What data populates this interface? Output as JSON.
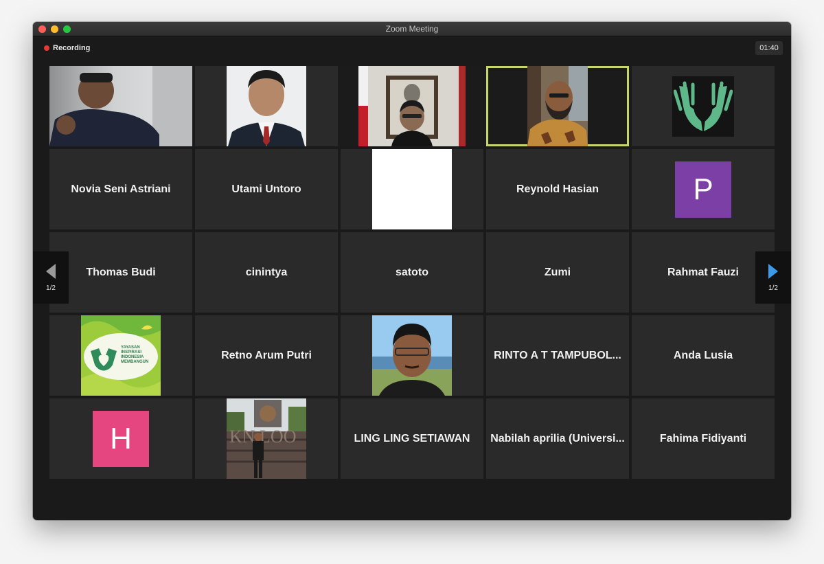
{
  "window": {
    "title": "Zoom Meeting"
  },
  "recording": {
    "label": "Recording"
  },
  "timer": "01:40",
  "nav": {
    "prev_page": "1/2",
    "next_page": "1/2"
  },
  "participants": {
    "novia": "Novia Seni Astriani",
    "utami": "Utami Untoro",
    "reynold": "Reynold Hasian",
    "p_initial": "P",
    "thomas": "Thomas Budi",
    "cinintya": "cinintya",
    "satoto": "satoto",
    "zumi": "Zumi",
    "rahmat": "Rahmat Fauzi",
    "retno": "Retno Arum Putri",
    "rinto": "RINTO A T TAMPUBOL...",
    "anda": "Anda Lusia",
    "h_initial": "H",
    "ling": "LING LING SETIAWAN",
    "nabilah": "Nabilah aprilia (Universi...",
    "fahima": "Fahima Fidiyanti"
  },
  "logo": {
    "yayasan": "YAYASAN",
    "inspirasi": "INSPIRASI",
    "indonesia": "INDONESIA",
    "membangun": "MEMBANGUN"
  },
  "colors": {
    "p_avatar": "#7b3fa6",
    "h_avatar": "#e64680",
    "active_border": "#c6d66b",
    "recording": "#e53935"
  }
}
